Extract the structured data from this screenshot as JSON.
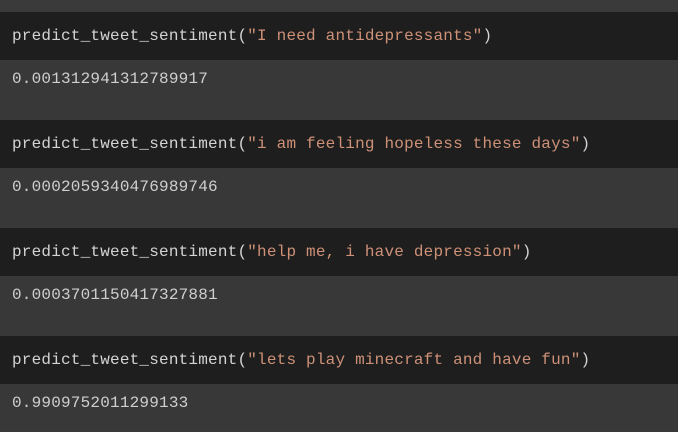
{
  "cells": [
    {
      "function_name": "predict_tweet_sentiment",
      "argument": "\"I need antidepressants\"",
      "output": "0.001312941312789917"
    },
    {
      "function_name": "predict_tweet_sentiment",
      "argument": "\"i am feeling hopeless these days\"",
      "output": "0.0002059340476989746"
    },
    {
      "function_name": "predict_tweet_sentiment",
      "argument": "\"help me, i have depression\"",
      "output": "0.0003701150417327881"
    },
    {
      "function_name": "predict_tweet_sentiment",
      "argument": "\"lets play minecraft and have fun\"",
      "output": "0.9909752011299133"
    }
  ],
  "punctuation": {
    "open": "(",
    "close": ")"
  },
  "colors": {
    "code_background": "#1e1e1e",
    "output_background": "#383838",
    "default_text": "#d4d4d4",
    "string_literal": "#ce9178",
    "output_text": "#cfcfcf"
  }
}
